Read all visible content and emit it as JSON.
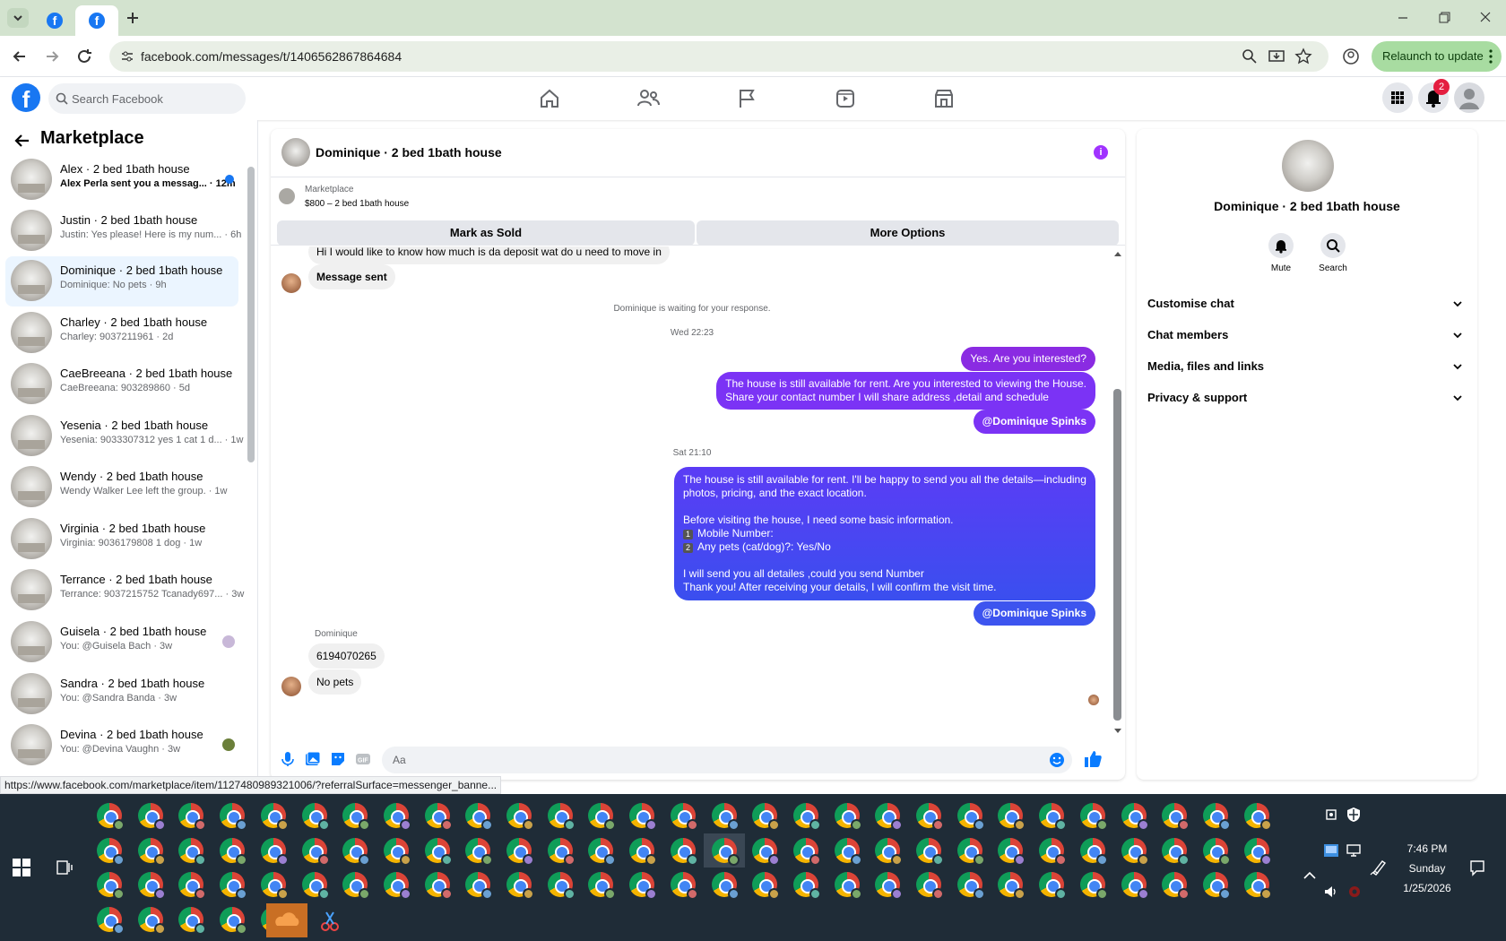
{
  "browser": {
    "url": "facebook.com/messages/t/1406562867864684",
    "relaunch_label": "Relaunch to update",
    "status_url": "https://www.facebook.com/marketplace/item/1127480989321006/?referralSurface=messenger_banne..."
  },
  "fb_header": {
    "search_placeholder": "Search Facebook",
    "notification_count": "2"
  },
  "sidebar": {
    "title": "Marketplace",
    "conversations": [
      {
        "name": "Alex · 2 bed 1bath house",
        "snippet": "Alex Perla sent you a messag... · 12m",
        "unread": true
      },
      {
        "name": "Justin · 2 bed 1bath house",
        "snippet": "Justin: Yes please! Here is my num... · 6h"
      },
      {
        "name": "Dominique · 2 bed 1bath house",
        "snippet": "Dominique: No pets · 9h",
        "active": true
      },
      {
        "name": "Charley · 2 bed 1bath house",
        "snippet": "Charley: 9037211961 · 2d"
      },
      {
        "name": "CaeBreeana · 2 bed 1bath house",
        "snippet": "CaeBreeana: 903289860 · 5d"
      },
      {
        "name": "Yesenia · 2 bed 1bath house",
        "snippet": "Yesenia: 9033307312 yes 1 cat 1 d... · 1w"
      },
      {
        "name": "Wendy · 2 bed 1bath house",
        "snippet": "Wendy Walker Lee left the group. · 1w"
      },
      {
        "name": "Virginia · 2 bed 1bath house",
        "snippet": "Virginia: 9036179808 1 dog · 1w"
      },
      {
        "name": "Terrance · 2 bed 1bath house",
        "snippet": "Terrance: 9037215752 Tcanady697... · 3w"
      },
      {
        "name": "Guisela · 2 bed 1bath house",
        "snippet": "You: @Guisela Bach · 3w"
      },
      {
        "name": "Sandra · 2 bed 1bath house",
        "snippet": "You: @Sandra Banda · 3w"
      },
      {
        "name": "Devina · 2 bed 1bath house",
        "snippet": "You: @Devina Vaughn · 3w"
      }
    ]
  },
  "chat": {
    "title": "Dominique · 2 bed 1bath house",
    "listing_label": "Marketplace",
    "listing_price": "$800 – 2 bed 1bath house",
    "mark_sold": "Mark as Sold",
    "more_options": "More Options",
    "messages": {
      "partial_top": "Hi I would like to know how much is da deposit wat do u need to move in",
      "message_sent": "Message sent",
      "waiting": "Dominique is waiting for your response.",
      "time1": "Wed 22:23",
      "out1": "Yes. Are you interested?",
      "out2_line1": "The house is still available for rent. Are you interested to viewing  the House.",
      "out2_line2": "Share your contact number I will share address ,detail and schedule",
      "mention1": "@Dominique Spinks",
      "time2": "Sat 21:10",
      "out3_p1": "The house is still available for rent. I'll be happy to send you all the details—including photos, pricing, and the exact location.",
      "out3_p2": "Before visiting the house, I need some basic information.",
      "out3_l1_num": "1",
      "out3_l1": "Mobile Number:",
      "out3_l2_num": "2",
      "out3_l2": "Any pets (cat/dog)?: Yes/No",
      "out3_p3": "I will send you all detailes ,could you send Number",
      "out3_p4": "Thank you! After receiving your details, I will confirm the visit time.",
      "mention2": "@Dominique Spinks",
      "sender": "Dominique",
      "in1": "6194070265",
      "in2": "No pets"
    },
    "composer_placeholder": "Aa"
  },
  "right_panel": {
    "name": "Dominique · 2 bed 1bath house",
    "mute": "Mute",
    "search": "Search",
    "sections": [
      "Customise chat",
      "Chat members",
      "Media, files and links",
      "Privacy & support"
    ]
  },
  "taskbar": {
    "time": "7:46 PM",
    "day": "Sunday",
    "date": "1/25/2026"
  }
}
